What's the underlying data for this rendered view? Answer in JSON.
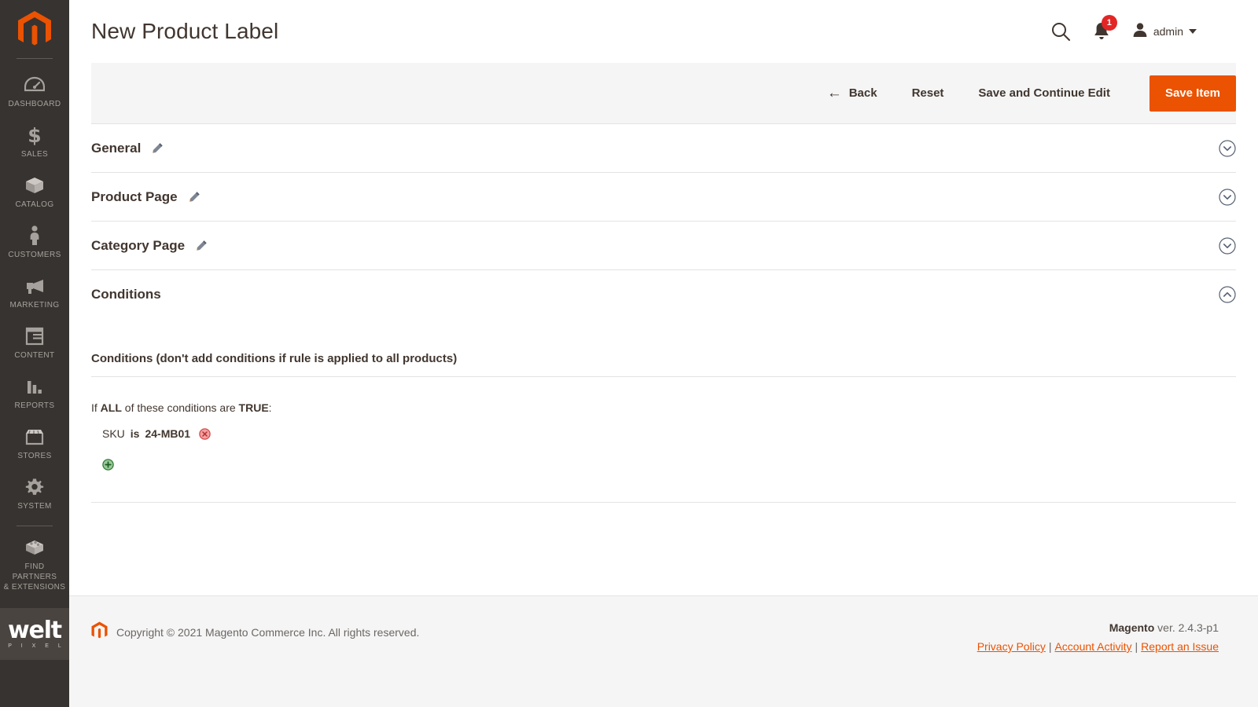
{
  "sidebar": {
    "logo_icon": "magento-logo-icon",
    "items": [
      {
        "label": "DASHBOARD",
        "icon": "dashboard-gauge-icon"
      },
      {
        "label": "SALES",
        "icon": "dollar-sign-icon"
      },
      {
        "label": "CATALOG",
        "icon": "box-icon"
      },
      {
        "label": "CUSTOMERS",
        "icon": "person-icon"
      },
      {
        "label": "MARKETING",
        "icon": "megaphone-icon"
      },
      {
        "label": "CONTENT",
        "icon": "layout-icon"
      },
      {
        "label": "REPORTS",
        "icon": "bar-chart-icon"
      },
      {
        "label": "STORES",
        "icon": "storefront-icon"
      },
      {
        "label": "SYSTEM",
        "icon": "gear-icon"
      },
      {
        "label": "FIND PARTNERS\n& EXTENSIONS",
        "icon": "extension-brick-icon"
      }
    ],
    "find_partners_line1": "FIND PARTNERS",
    "find_partners_line2": "& EXTENSIONS",
    "branding": {
      "primary": "welt",
      "secondary": "P I X E L"
    }
  },
  "header": {
    "title": "New Product Label",
    "search_icon": "search-icon",
    "notifications_icon": "bell-icon",
    "notifications_count": "1",
    "user_icon": "user-avatar-icon",
    "user_name": "admin",
    "caret_icon": "caret-down-icon"
  },
  "toolbar": {
    "back_label": "Back",
    "back_icon": "arrow-left-icon",
    "reset_label": "Reset",
    "save_continue_label": "Save and Continue Edit",
    "save_label": "Save Item"
  },
  "sections": [
    {
      "title": "General",
      "edit_icon": "pencil-icon",
      "expanded": false,
      "chevron": "chevron-down-circle-icon"
    },
    {
      "title": "Product Page",
      "edit_icon": "pencil-icon",
      "expanded": false,
      "chevron": "chevron-down-circle-icon"
    },
    {
      "title": "Category Page",
      "edit_icon": "pencil-icon",
      "expanded": false,
      "chevron": "chevron-down-circle-icon"
    },
    {
      "title": "Conditions",
      "edit_icon": "",
      "expanded": true,
      "chevron": "chevron-up-circle-icon"
    }
  ],
  "conditions": {
    "legend": "Conditions (don't add conditions if rule is applied to all products)",
    "if_text": "If",
    "aggregator": "ALL",
    "mid_text": "of these conditions are",
    "value_bool": "TRUE",
    "colon": ":",
    "rows": [
      {
        "attribute": "SKU",
        "operator": "is",
        "value": "24-MB01",
        "remove_icon": "remove-circle-icon"
      }
    ],
    "add_icon": "add-circle-icon"
  },
  "footer": {
    "logo_icon": "magento-logo-icon",
    "copyright": "Copyright © 2021 Magento Commerce Inc. All rights reserved.",
    "brand": "Magento",
    "version": " ver. 2.4.3-p1",
    "links": [
      {
        "label": "Privacy Policy"
      },
      {
        "label": "Account Activity"
      },
      {
        "label": "Report an Issue"
      }
    ],
    "separator": "|"
  },
  "colors": {
    "accent": "#eb5202",
    "sidebar_bg": "#373330",
    "badge": "#e22626",
    "panel_bg": "#f5f5f5",
    "text": "#41362f"
  }
}
